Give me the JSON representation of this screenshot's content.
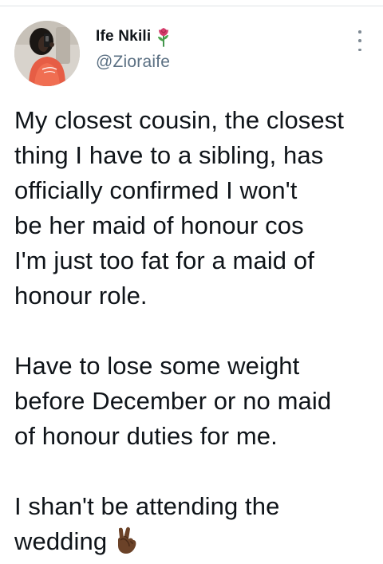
{
  "author": {
    "display_name": "Ife Nkili",
    "handle": "@Zioraife",
    "name_emoji_icon": "rose-icon"
  },
  "menu": {
    "icon": "more-vertical-icon"
  },
  "tweet": {
    "paragraphs": [
      {
        "lines": [
          "My closest cousin, the closest",
          "thing I have to a sibling, has",
          "officially confirmed I won't",
          "be her maid of honour cos",
          "I'm just too fat for a maid of",
          "honour role."
        ]
      },
      {
        "lines": [
          "Have to lose some weight",
          "before December or no maid",
          "of honour duties for me."
        ]
      },
      {
        "lines": [
          "I shan't be attending the",
          "wedding"
        ],
        "trailing_icon": "victory-hand-icon"
      }
    ]
  },
  "colors": {
    "text": "#0f1419",
    "secondary_text": "#5b7083",
    "divider": "#dfe3e6",
    "rose": "#d43c6b",
    "victory_hand": "#6b4228"
  }
}
